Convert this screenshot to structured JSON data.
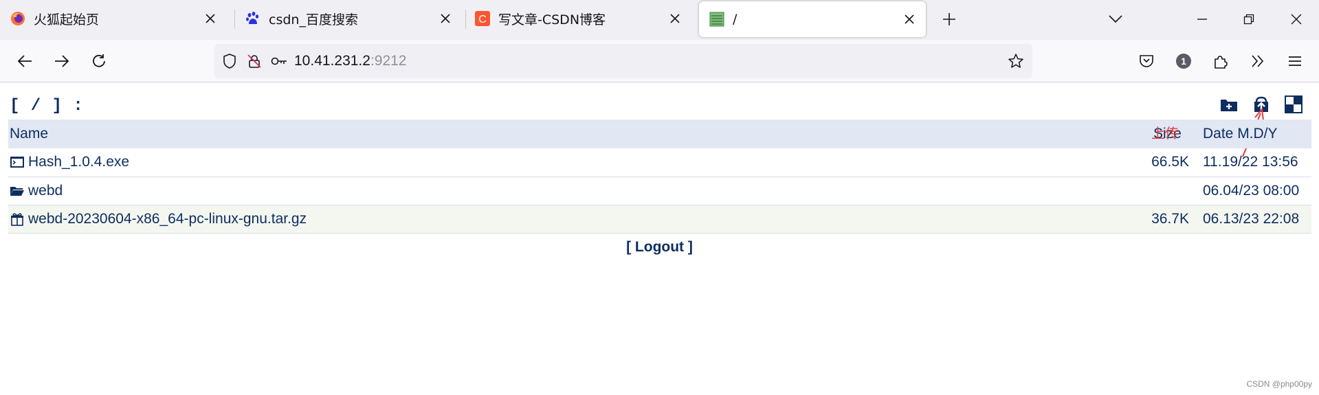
{
  "tabs": [
    {
      "title": "火狐起始页",
      "icon": "firefox-icon",
      "active": false
    },
    {
      "title": "csdn_百度搜索",
      "icon": "baidu-paw-icon",
      "active": false
    },
    {
      "title": "写文章-CSDN博客",
      "icon": "csdn-icon",
      "active": false
    },
    {
      "title": "/",
      "icon": "listing-page-icon",
      "active": true
    }
  ],
  "url": {
    "host": "10.41.231.2",
    "port": ":9212"
  },
  "toolbar": {
    "account_badge": "1"
  },
  "page": {
    "title": "[ / ] :",
    "columns": {
      "name": "Name",
      "size": "Size",
      "date": "Date M.D/Y"
    },
    "files": [
      {
        "name": "Hash_1.0.4.exe",
        "size": "66.5K",
        "date": "11.19/22 13:56",
        "icon": "terminal-file-icon"
      },
      {
        "name": "webd",
        "size": "",
        "date": "06.04/23 08:00",
        "icon": "folder-icon"
      },
      {
        "name": "webd-20230604-x86_64-pc-linux-gnu.tar.gz",
        "size": "36.7K",
        "date": "06.13/23 22:08",
        "icon": "archive-gift-icon"
      }
    ],
    "logout": "[ Logout ]",
    "tools": [
      "new-folder-icon",
      "upload-icon",
      "toggle-view-icon"
    ]
  },
  "annotation": {
    "text": "上传",
    "color": "#e83a3a"
  },
  "watermark": "CSDN @php00py",
  "colors": {
    "link": "#0d2d5f",
    "header_bg": "#e1e7f3",
    "alt_row_bg": "#f4f6f0"
  }
}
